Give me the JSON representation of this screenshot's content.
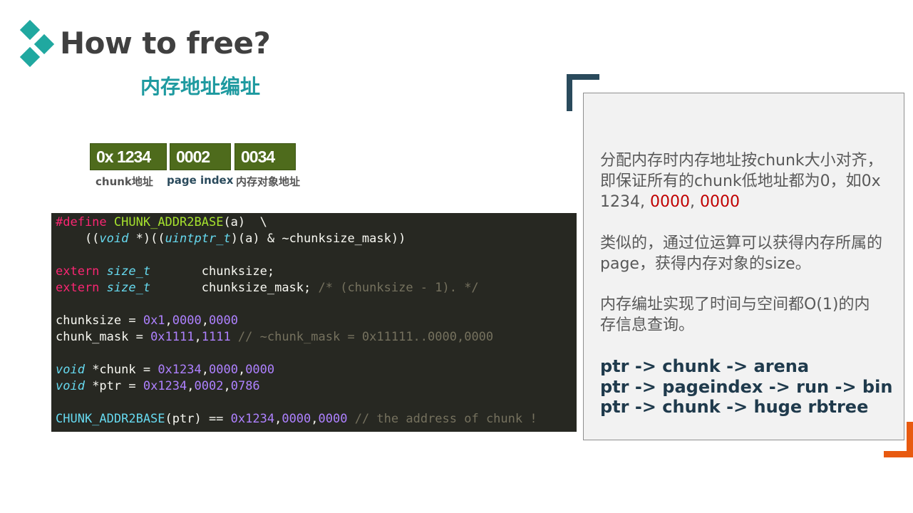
{
  "slide": {
    "title": "How to free?",
    "subtitle": "内存地址编址"
  },
  "address": {
    "boxes": [
      "0x 1234",
      "0002",
      "0034"
    ],
    "labels": [
      "chunk地址",
      "page index",
      "内存对象地址"
    ]
  },
  "code": {
    "line1": {
      "define": "#define",
      "macro": "CHUNK_ADDR2BASE",
      "rest": "(a)  \\"
    },
    "line2": {
      "p1": "    ((",
      "t1": "void",
      "p2": " *)((",
      "t2": "uintptr_t",
      "p3": ")(a) & ~chunksize_mask))"
    },
    "line3": {
      "kw": "extern",
      "t": "size_t",
      "rest": "       chunksize;"
    },
    "line4": {
      "kw": "extern",
      "t": "size_t",
      "rest": "       chunksize_mask; ",
      "comment": "/* (chunksize - 1). */"
    },
    "line5": {
      "lhs": "chunksize = ",
      "num": "0x1",
      "s1": ",",
      "n2": "0000",
      "s2": ",",
      "n3": "0000"
    },
    "line6": {
      "lhs": "chunk_mask = ",
      "num": "0x1111",
      "s1": ",",
      "n2": "1111",
      "comment": " // ~chunk_mask = 0x11111..0000,0000"
    },
    "line7": {
      "t": "void",
      "lhs": " *chunk = ",
      "num": "0x1234",
      "s1": ",",
      "n2": "0000",
      "s2": ",",
      "n3": "0000"
    },
    "line8": {
      "t": "void",
      "lhs": " *ptr = ",
      "num": "0x1234",
      "s1": ",",
      "n2": "0002",
      "s2": ",",
      "n3": "0786"
    },
    "line9": {
      "fn": "CHUNK_ADDR2BASE",
      "mid": "(ptr) == ",
      "num": "0x1234",
      "s1": ",",
      "n2": "0000",
      "s2": ",",
      "n3": "0000",
      "comment": " // the address of chunk !"
    }
  },
  "panel": {
    "p1_text": "分配内存时内存地址按chunk大小对齐，即保证所有的chunk低地址都为0，如0x 1234, ",
    "p1_red1": "0000",
    "p1_sep": ", ",
    "p1_red2": "0000",
    "p2": "类似的，通过位运算可以获得内存所属的page，获得内存对象的size。",
    "p3": "内存编址实现了时间与空间都O(1)的内存信息查询。",
    "arrows": [
      "ptr -> chunk -> arena",
      "ptr -> pageindex -> run -> bin",
      "ptr -> chunk -> huge rbtree"
    ]
  },
  "colors": {
    "accent_teal": "#1e9aa0",
    "address_box_green": "#4e6b1c",
    "code_bg": "#272822",
    "highlight_red": "#c00000",
    "bracket_dark": "#2a4a5c",
    "bracket_orange": "#e85a10"
  }
}
